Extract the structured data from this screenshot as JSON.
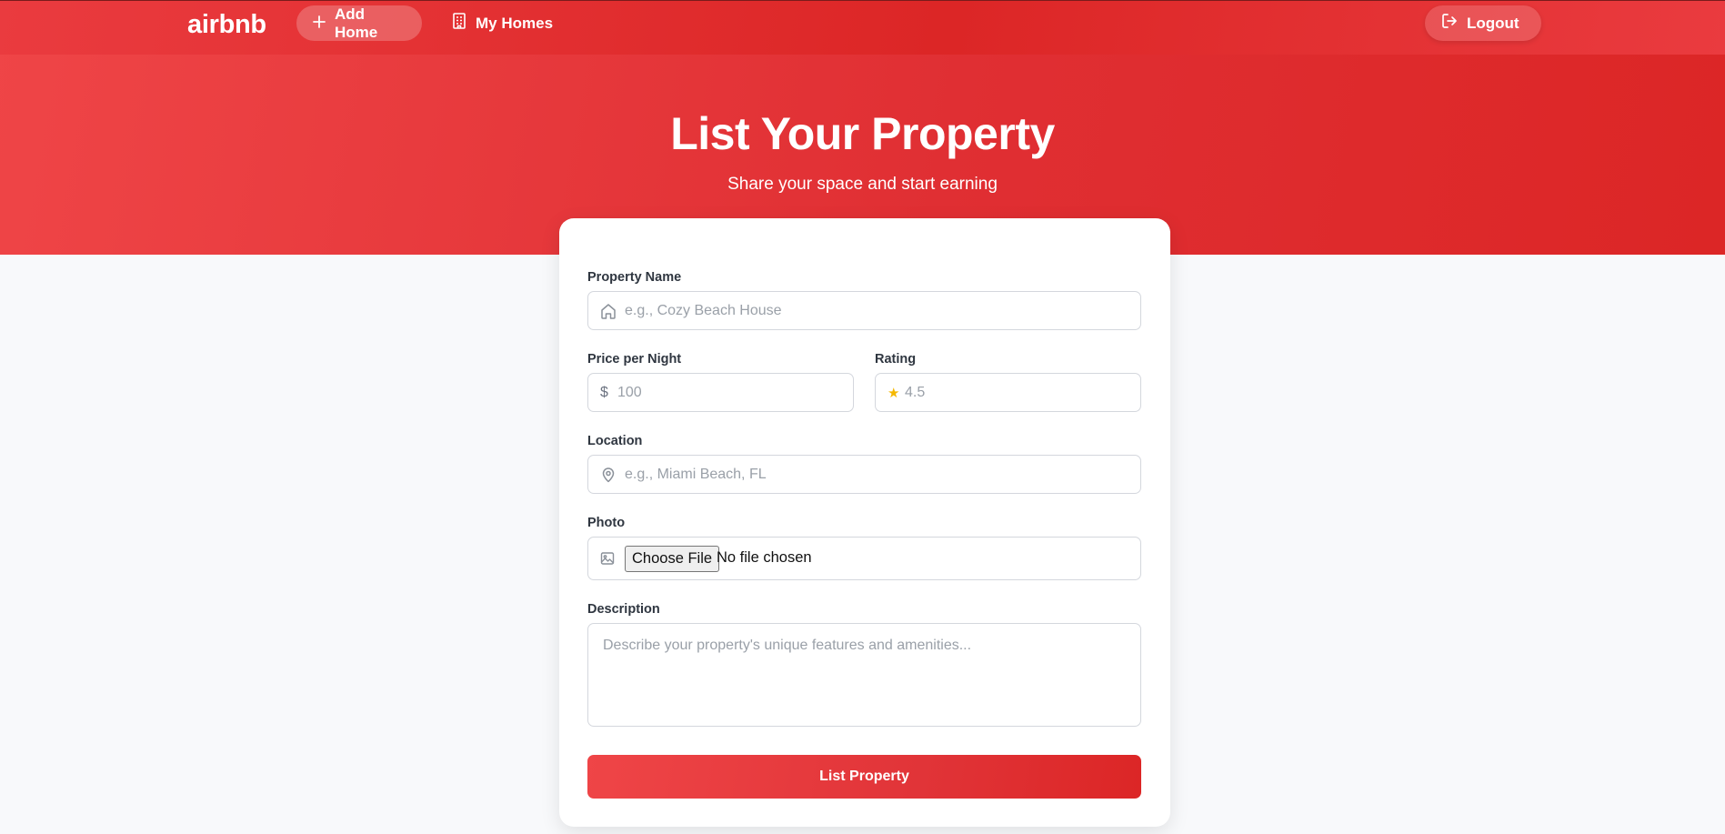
{
  "nav": {
    "brand": "airbnb",
    "add_home": "Add Home",
    "my_homes": "My Homes",
    "logout": "Logout"
  },
  "hero": {
    "title": "List Your Property",
    "subtitle": "Share your space and start earning"
  },
  "form": {
    "property_name": {
      "label": "Property Name",
      "placeholder": "e.g., Cozy Beach House",
      "value": "",
      "icon": "home-icon"
    },
    "price": {
      "label": "Price per Night",
      "prefix": "$",
      "placeholder": "100",
      "value": ""
    },
    "rating": {
      "label": "Rating",
      "prefix": "★",
      "placeholder": "4.5",
      "value": ""
    },
    "location": {
      "label": "Location",
      "placeholder": "e.g., Miami Beach, FL",
      "value": "",
      "icon": "map-pin-icon"
    },
    "photo": {
      "label": "Photo",
      "button": "Choose File",
      "status": "No file chosen",
      "icon": "image-icon"
    },
    "description": {
      "label": "Description",
      "placeholder": "Describe your property's unique features and amenities...",
      "value": ""
    },
    "submit": "List Property"
  },
  "colors": {
    "brand_red": "#dc2626",
    "brand_red_light": "#ef4547",
    "star": "#f5b800",
    "page_bg": "#f8f9fb"
  }
}
